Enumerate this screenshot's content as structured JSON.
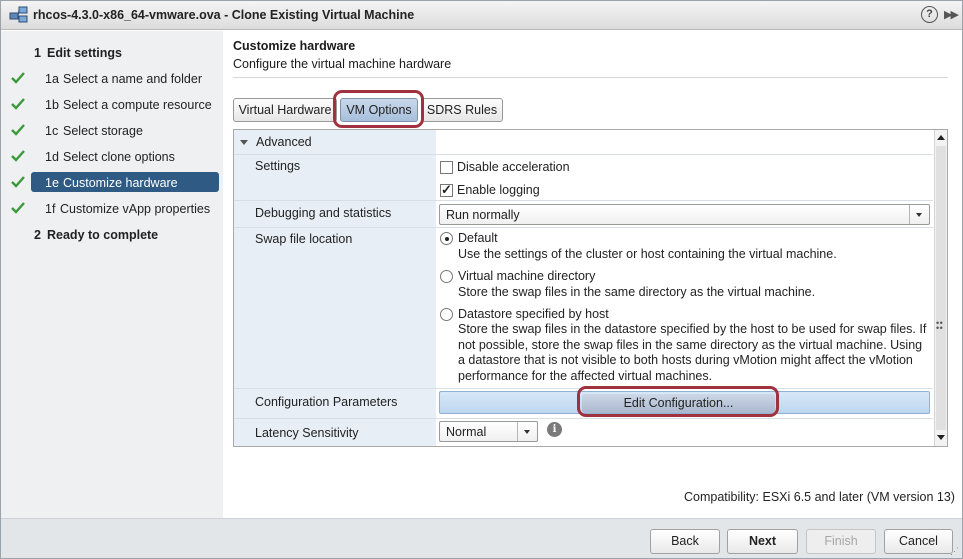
{
  "window": {
    "title": "rhcos-4.3.0-x86_64-vmware.ova - Clone Existing Virtual Machine",
    "help_label": "?",
    "expand_label": "▶▶"
  },
  "nav": {
    "step1": {
      "num": "1",
      "label": "Edit settings"
    },
    "substeps": [
      {
        "num": "1a",
        "label": "Select a name and folder",
        "done": true
      },
      {
        "num": "1b",
        "label": "Select a compute resource",
        "done": true
      },
      {
        "num": "1c",
        "label": "Select storage",
        "done": true
      },
      {
        "num": "1d",
        "label": "Select clone options",
        "done": true
      },
      {
        "num": "1e",
        "label": "Customize hardware",
        "done": true,
        "active": true
      },
      {
        "num": "1f",
        "label": "Customize vApp properties",
        "done": true
      }
    ],
    "step2": {
      "num": "2",
      "label": "Ready to complete"
    }
  },
  "main": {
    "title": "Customize hardware",
    "subtitle": "Configure the virtual machine hardware",
    "tabs": [
      {
        "label": "Virtual Hardware",
        "selected": false
      },
      {
        "label": "VM Options",
        "selected": true
      },
      {
        "label": "SDRS Rules",
        "selected": false
      }
    ]
  },
  "advanced": {
    "section_label": "Advanced",
    "settings": {
      "label": "Settings",
      "disable_acceleration": {
        "label": "Disable acceleration",
        "checked": false
      },
      "enable_logging": {
        "label": "Enable logging",
        "checked": true
      }
    },
    "debugging": {
      "label": "Debugging and statistics",
      "value": "Run normally"
    },
    "swap": {
      "label": "Swap file location",
      "selected": "default",
      "options": {
        "default": {
          "label": "Default",
          "desc": "Use the settings of the cluster or host containing the virtual machine."
        },
        "vmdir": {
          "label": "Virtual machine directory",
          "desc": "Store the swap files in the same directory as the virtual machine."
        },
        "host": {
          "label": "Datastore specified by host",
          "desc": "Store the swap files in the datastore specified by the host to be used for swap files. If not possible, store the swap files in the same directory as the virtual machine. Using a datastore that is not visible to both hosts during vMotion might affect the vMotion performance for the affected virtual machines."
        }
      }
    },
    "config_params": {
      "label": "Configuration Parameters",
      "button": "Edit Configuration..."
    },
    "latency": {
      "label": "Latency Sensitivity",
      "value": "Normal"
    }
  },
  "compatibility": "Compatibility: ESXi 6.5 and later (VM version 13)",
  "footer": {
    "back": "Back",
    "next": "Next",
    "finish": "Finish",
    "cancel": "Cancel"
  },
  "colors": {
    "nav_active": "#2e5a83",
    "callout": "#a0323f",
    "label_column": "#e7eef5",
    "edit_button": "#bdd7f0"
  }
}
